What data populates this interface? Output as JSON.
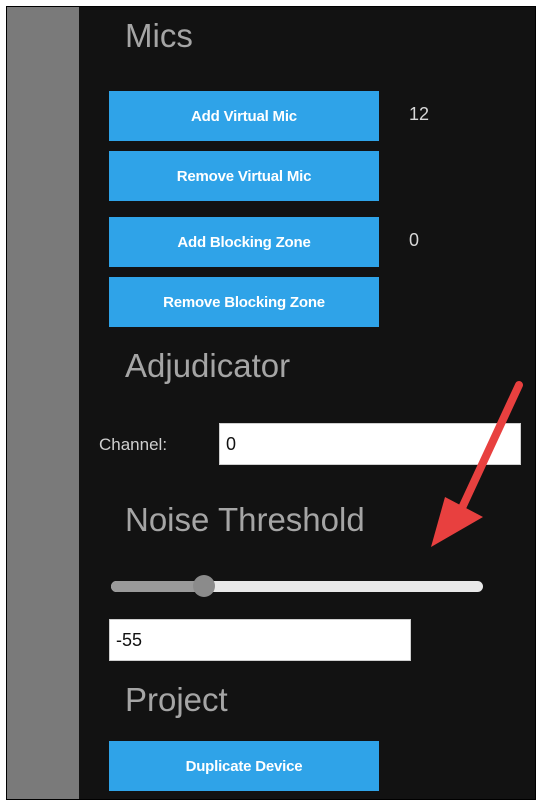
{
  "mics": {
    "title": "Mics",
    "add_virtual_mic": "Add Virtual Mic",
    "virtual_mic_count": "12",
    "remove_virtual_mic": "Remove Virtual Mic",
    "add_blocking_zone": "Add Blocking Zone",
    "blocking_zone_count": "0",
    "remove_blocking_zone": "Remove Blocking Zone"
  },
  "adjudicator": {
    "title": "Adjudicator",
    "channel_label": "Channel:",
    "channel_value": "0"
  },
  "noise_threshold": {
    "title": "Noise Threshold",
    "slider_fraction": 0.25,
    "value": "-55"
  },
  "project": {
    "title": "Project",
    "duplicate_device": "Duplicate Device"
  },
  "colors": {
    "panel_bg": "#121212",
    "button_bg": "#2fa3e8",
    "arrow": "#e8403f"
  },
  "annotation": {
    "icon": "red-arrow-icon"
  }
}
